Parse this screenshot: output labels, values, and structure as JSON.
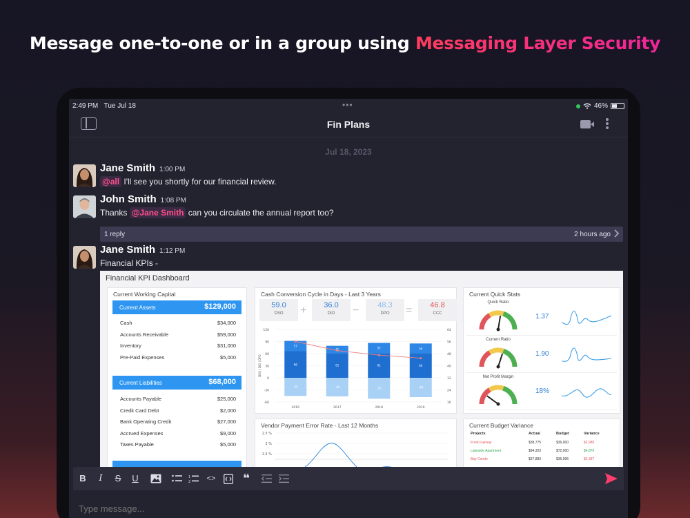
{
  "headline": {
    "prefix": "Message one-to-one  or in a group using ",
    "accent": "Messaging Layer Security"
  },
  "status": {
    "time": "2:49 PM",
    "date": "Tue Jul 18",
    "battery": "46%",
    "battery_level": 0.46
  },
  "nav": {
    "title": "Fin Plans"
  },
  "date_divider": "Jul 18, 2023",
  "messages": [
    {
      "name": "Jane Smith",
      "time": "1:00 PM",
      "mention": "@all",
      "text": " I'll see you shortly for our financial review."
    },
    {
      "name": "John Smith",
      "time": "1:08 PM",
      "prefix": "Thanks ",
      "mention": "@Jane Smith",
      "text": " can you circulate the annual report too?"
    },
    {
      "name": "Jane Smith",
      "time": "1:12 PM",
      "text": "Financial KPIs -"
    }
  ],
  "thread": {
    "replies": "1 reply",
    "ago": "2 hours ago"
  },
  "dashboard": {
    "title": "Financial KPI Dashboard",
    "working_capital": {
      "title": "Current Working Capital",
      "assets": {
        "label": "Current Assets",
        "total": "$129,000",
        "rows": [
          [
            "Cash",
            "$34,000"
          ],
          [
            "Accounts Receivable",
            "$59,000"
          ],
          [
            "Inventory",
            "$31,000"
          ],
          [
            "Pre-Paid Expenses",
            "$5,000"
          ]
        ]
      },
      "liabilities": {
        "label": "Current Liabilities",
        "total": "$68,000",
        "rows": [
          [
            "Accounts Payable",
            "$25,000"
          ],
          [
            "Credit Card Debt",
            "$2,000"
          ],
          [
            "Bank Operating Credit",
            "$27,000"
          ],
          [
            "Accrued Expenses",
            "$9,000"
          ],
          [
            "Taxes Payable",
            "$5,000"
          ]
        ]
      }
    },
    "ccc": {
      "title": "Cash Conversion Cycle in Days - Last 3 Years",
      "boxes": [
        {
          "num": "59.0",
          "lbl": "DSO",
          "color": "#2e7fd6"
        },
        {
          "num": "36.0",
          "lbl": "DIO",
          "color": "#2e7fd6"
        },
        {
          "num": "48.3",
          "lbl": "DPO",
          "color": "#8fbfee"
        },
        {
          "num": "46.8",
          "lbl": "CCC",
          "color": "#e0555a"
        }
      ],
      "ops": [
        "+",
        "−",
        "="
      ],
      "ylabel": "DSO | DIO | DPO",
      "yticks": [
        "120",
        "90",
        "60",
        "30",
        "0",
        "-30",
        "-60"
      ],
      "y2ticks": [
        "64",
        "56",
        "48",
        "40",
        "32",
        "24",
        "16"
      ],
      "years": [
        "2016",
        "2017",
        "2018",
        "2019"
      ],
      "dso": [
        57,
        41,
        57,
        56
      ],
      "dio": [
        66,
        61,
        61,
        60
      ],
      "dpo": [
        -45,
        -46,
        -52,
        -48
      ],
      "ccc": [
        56,
        50,
        47,
        45
      ]
    },
    "quick_stats": {
      "title": "Current Quick Stats",
      "items": [
        {
          "label": "Quick Ratio",
          "value": "1.37",
          "needle": 0.55
        },
        {
          "label": "Current Ratio",
          "value": "1.90",
          "needle": 0.6
        },
        {
          "label": "Net Profit Margin",
          "value": "18%",
          "needle": 0.2
        }
      ]
    },
    "vendor": {
      "title": "Vendor Payment Error Rate - Last 12 Months",
      "yticks": [
        "2.5 %",
        "2 %",
        "1.5 %"
      ]
    },
    "budget": {
      "title": "Current Budget Variance",
      "headers": [
        "Projects",
        "Actual",
        "Budget",
        "Variance"
      ],
      "rows": [
        {
          "cells": [
            "Front Fairway",
            "$38,775",
            "$36,000",
            "$2,985"
          ],
          "color": "#e0555a"
        },
        {
          "cells": [
            "Lakeside Apartment",
            "$94,323",
            "$72,000",
            "$4,876"
          ],
          "color": "#3aa655"
        },
        {
          "cells": [
            "Bay Condo",
            "$37,883",
            "$35,996",
            "$2,387"
          ],
          "color": "#e0555a"
        }
      ]
    }
  },
  "composer": {
    "placeholder": "Type message..."
  },
  "colors": {
    "accent": "#ff4f8a",
    "bar_dark": "#2e86e6",
    "bar_mid": "#1f6fd0",
    "bar_light": "#a9d0f5",
    "ccc_line": "#f08080"
  }
}
